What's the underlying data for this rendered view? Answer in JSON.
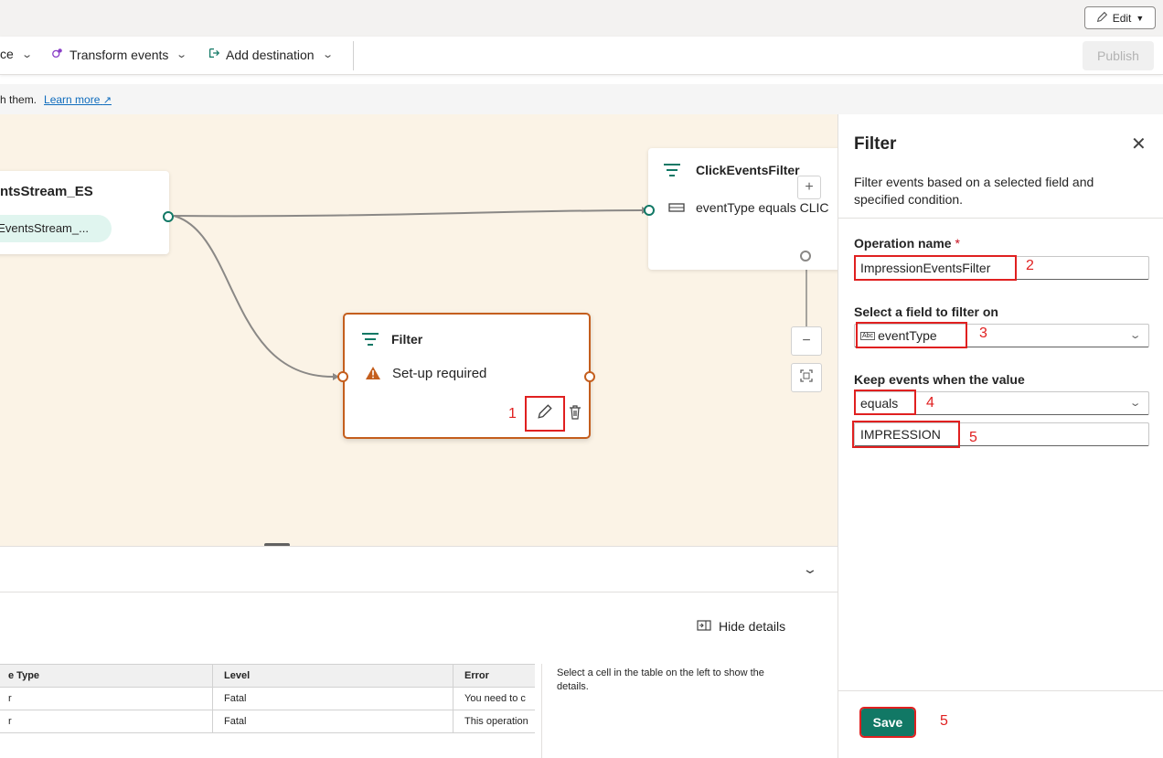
{
  "header": {
    "edit_label": "Edit"
  },
  "toolbar": {
    "source_label": "ce",
    "transform_label": "Transform events",
    "destination_label": "Add destination",
    "publish_label": "Publish"
  },
  "info_bar": {
    "text": "h them.",
    "link": "Learn more"
  },
  "canvas": {
    "source_node": {
      "title": "ntsStream_ES",
      "pill": "oEventsStream_..."
    },
    "click_node": {
      "title": "ClickEventsFilter",
      "condition": "eventType equals CLIC"
    },
    "filter_node": {
      "title": "Filter",
      "status": "Set-up required"
    }
  },
  "annotations": {
    "n1": "1",
    "n2": "2",
    "n3": "3",
    "n4": "4",
    "n5a": "5",
    "n5b": "5"
  },
  "bottom_panel": {
    "hide_details_label": "Hide details",
    "columns": [
      "e Type",
      "Level",
      "Error"
    ],
    "rows": [
      [
        "r",
        "Fatal",
        "You need to c"
      ],
      [
        "r",
        "Fatal",
        "This operation"
      ]
    ],
    "details_hint": "Select a cell in the table on the left to show the details."
  },
  "panel": {
    "title": "Filter",
    "description": "Filter events based on a selected field and specified condition.",
    "operation_name_label": "Operation name",
    "required_mark": "*",
    "operation_name_value": "ImpressionEventsFilter",
    "field_label": "Select a field to filter on",
    "field_value": "eventType",
    "keep_label": "Keep events when the value",
    "operator_value": "equals",
    "match_value": "IMPRESSION",
    "save_label": "Save"
  },
  "colors": {
    "accent": "#117865",
    "warning": "#c45e1d",
    "annotation": "#e02020",
    "canvas_bg": "#fbf3e6"
  }
}
